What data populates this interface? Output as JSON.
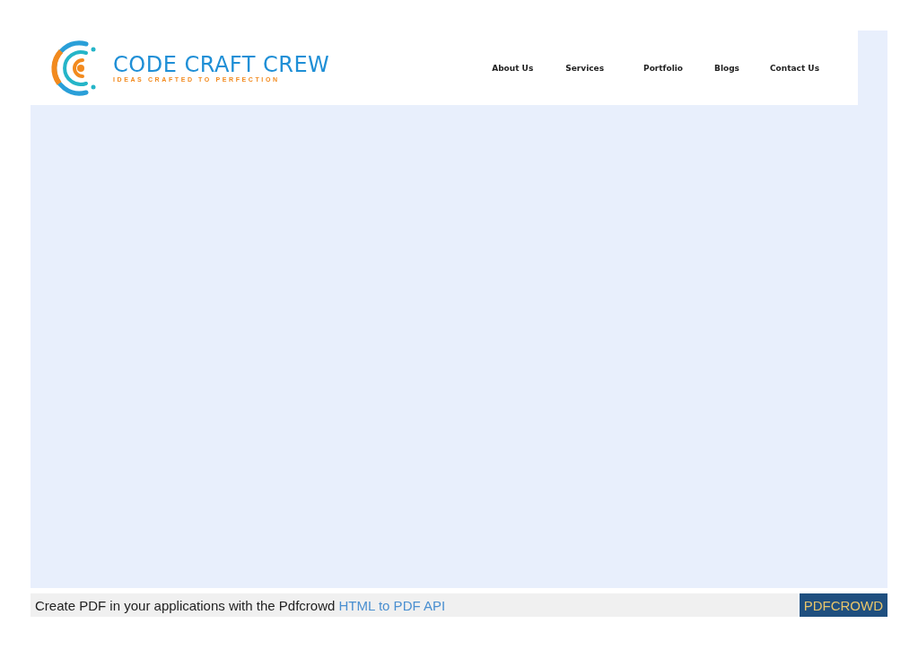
{
  "header": {
    "logo": {
      "name": "CODE CRAFT CREW",
      "tagline": "IDEAS CRAFTED TO PERFECTION"
    },
    "nav": [
      {
        "label": "About Us"
      },
      {
        "label": "Services"
      },
      {
        "label": "Portfolio"
      },
      {
        "label": "Blogs"
      },
      {
        "label": "Contact Us"
      }
    ]
  },
  "footer": {
    "text": "Create PDF in your applications with the Pdfcrowd",
    "link": "HTML to PDF API",
    "button": "PDFCROWD"
  }
}
